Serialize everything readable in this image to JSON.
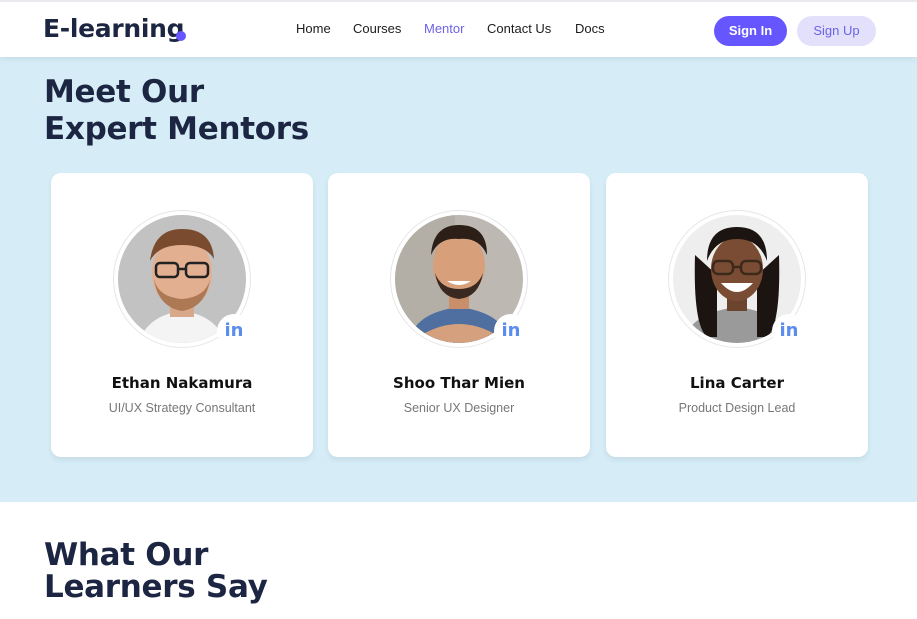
{
  "header": {
    "logo_text": "E-learning",
    "nav": [
      {
        "label": "Home",
        "active": false
      },
      {
        "label": "Courses",
        "active": false
      },
      {
        "label": "Mentor",
        "active": true
      },
      {
        "label": "Contact Us",
        "active": false
      },
      {
        "label": "Docs",
        "active": false
      }
    ],
    "sign_in_label": "Sign In",
    "sign_up_label": "Sign Up"
  },
  "mentors_section": {
    "title_line1": "Meet Our",
    "title_line2": "Expert Mentors",
    "mentors": [
      {
        "name": "Ethan Nakamura",
        "role": "UI/UX Strategy Consultant",
        "social_icon": "linkedin-icon",
        "social_text": "in"
      },
      {
        "name": "Shoo Thar Mien",
        "role": "Senior UX Designer",
        "social_icon": "linkedin-icon",
        "social_text": "in"
      },
      {
        "name": "Lina Carter",
        "role": "Product Design Lead",
        "social_icon": "linkedin-icon",
        "social_text": "in"
      }
    ]
  },
  "learners_section": {
    "title_line1": "What Our",
    "title_line2": "Learners Say"
  },
  "colors": {
    "brand_primary": "#6556ff",
    "nav_active": "#6c63e6",
    "section_bg": "#d6edf8",
    "heading": "#1c2541",
    "linkedin": "#5b8def"
  }
}
